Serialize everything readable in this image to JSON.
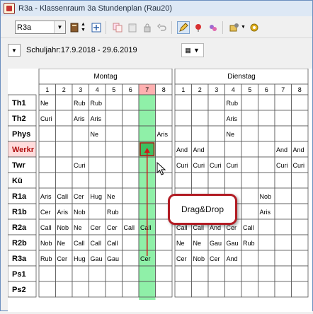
{
  "window": {
    "title": "R3a - Klassenraum 3a  Stundenplan  (Rau20)"
  },
  "toolbar": {
    "room_value": "R3a",
    "icons": [
      "combo-dropdown-icon",
      "book-icon",
      "spin-icon",
      "grid-plus-icon",
      "copy-icon",
      "paste-icon",
      "lock-icon",
      "undo-icon",
      "pencil-icon",
      "pin-icon",
      "swap-icon",
      "settings-icon",
      "gear-icon"
    ]
  },
  "subbar": {
    "period": "Schuljahr:17.9.2018 - 29.6.2019"
  },
  "timetable": {
    "days": [
      "Montag",
      "Dienstag"
    ],
    "periods": [
      "1",
      "2",
      "3",
      "4",
      "5",
      "6",
      "7",
      "8"
    ],
    "highlight_period_index": 6,
    "highlight_color": "#8ff0a8",
    "header_highlight_color": "#ffb0b0",
    "rows": [
      {
        "label": "Th1",
        "cells": [
          "Ne",
          "",
          "Rub",
          "Rub",
          "",
          "",
          "",
          "",
          "",
          "",
          "",
          "Rub",
          "",
          "",
          "",
          ""
        ]
      },
      {
        "label": "Th2",
        "cells": [
          "Curi",
          "",
          "Aris",
          "Aris",
          "",
          "",
          "",
          "",
          "",
          "",
          "",
          "Aris",
          "",
          "",
          "",
          ""
        ]
      },
      {
        "label": "Phys",
        "cells": [
          "",
          "",
          "",
          "Ne",
          "",
          "",
          "",
          "Aris",
          "",
          "",
          "",
          "Ne",
          "",
          "",
          "",
          ""
        ]
      },
      {
        "label": "Werkr",
        "cells": [
          "",
          "",
          "",
          "",
          "",
          "",
          "",
          "",
          "And",
          "And",
          "",
          "",
          "",
          "",
          "And",
          "And"
        ],
        "highlight": true
      },
      {
        "label": "Twr",
        "cells": [
          "",
          "",
          "Curi",
          "",
          "",
          "",
          "",
          "",
          "Curi",
          "Curi",
          "Curi",
          "Curi",
          "",
          "",
          "Curi",
          "Curi"
        ]
      },
      {
        "label": "Kü",
        "cells": [
          "",
          "",
          "",
          "",
          "",
          "",
          "",
          "",
          "",
          "",
          "",
          "",
          "",
          "",
          "",
          ""
        ]
      },
      {
        "label": "R1a",
        "cells": [
          "Aris",
          "Call",
          "Cer",
          "Hug",
          "Ne",
          "",
          "",
          "",
          "",
          "",
          "",
          "",
          "",
          "Nob",
          "",
          ""
        ]
      },
      {
        "label": "R1b",
        "cells": [
          "Cer",
          "Aris",
          "Nob",
          "",
          "Rub",
          "",
          "",
          "",
          "",
          "",
          "",
          "",
          "",
          "Aris",
          "",
          ""
        ]
      },
      {
        "label": "R2a",
        "cells": [
          "Call",
          "Nob",
          "Ne",
          "Cer",
          "Cer",
          "Call",
          "Call",
          "",
          "Call",
          "Call",
          "And",
          "Cer",
          "Call",
          "",
          "",
          ""
        ]
      },
      {
        "label": "R2b",
        "cells": [
          "Nob",
          "Ne",
          "Call",
          "Call",
          "Call",
          "",
          "",
          "",
          "Ne",
          "Ne",
          "Gau",
          "Gau",
          "Rub",
          "",
          "",
          ""
        ]
      },
      {
        "label": "R3a",
        "cells": [
          "Rub",
          "Cer",
          "Hug",
          "Gau",
          "Gau",
          "",
          "Cer",
          "",
          "Cer",
          "Nob",
          "Cer",
          "And",
          "",
          "",
          "",
          ""
        ]
      },
      {
        "label": "Ps1",
        "cells": [
          "",
          "",
          "",
          "",
          "",
          "",
          "",
          "",
          "",
          "",
          "",
          "",
          "",
          "",
          "",
          ""
        ]
      },
      {
        "label": "Ps2",
        "cells": [
          "",
          "",
          "",
          "",
          "",
          "",
          "",
          "",
          "",
          "",
          "",
          "",
          "",
          "",
          "",
          ""
        ]
      }
    ]
  },
  "callout": {
    "text": "Drag&Drop"
  }
}
